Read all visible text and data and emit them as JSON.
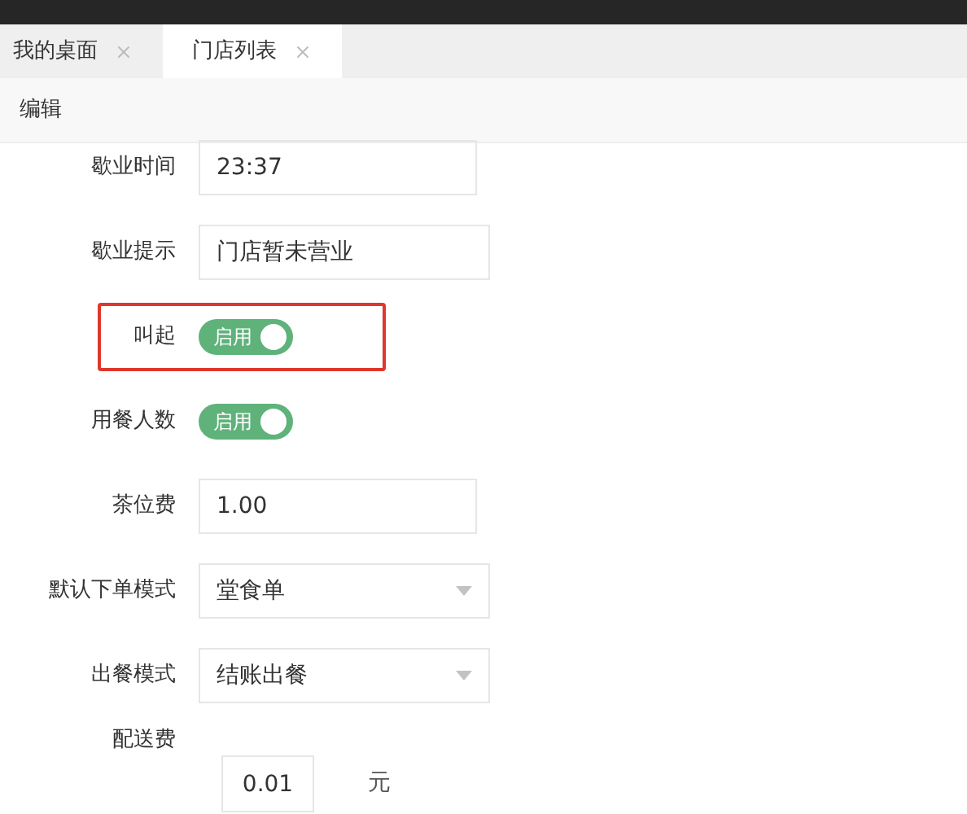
{
  "tabs": [
    {
      "label": "我的桌面",
      "selected": false
    },
    {
      "label": "门店列表",
      "selected": true
    }
  ],
  "toolbar": {
    "title": "编辑"
  },
  "fields": [
    {
      "kind": "text",
      "label": "歇业时间",
      "value": "23:37",
      "highlighted": false
    },
    {
      "kind": "text",
      "label": "歇业提示",
      "value": "门店暂未营业",
      "highlighted": false
    },
    {
      "kind": "toggle",
      "label": "叫起",
      "text": "启用",
      "on": true,
      "highlighted": true
    },
    {
      "kind": "toggle",
      "label": "用餐人数",
      "text": "启用",
      "on": true,
      "highlighted": false
    },
    {
      "kind": "text",
      "label": "茶位费",
      "value": "1.00",
      "highlighted": false
    },
    {
      "kind": "select",
      "label": "默认下单模式",
      "value": "堂食单",
      "highlighted": false
    },
    {
      "kind": "select",
      "label": "出餐模式",
      "value": "结账出餐",
      "highlighted": false
    },
    {
      "kind": "unit",
      "label": "配送费",
      "value": "0.01",
      "unit": "元",
      "highlighted": false
    }
  ]
}
